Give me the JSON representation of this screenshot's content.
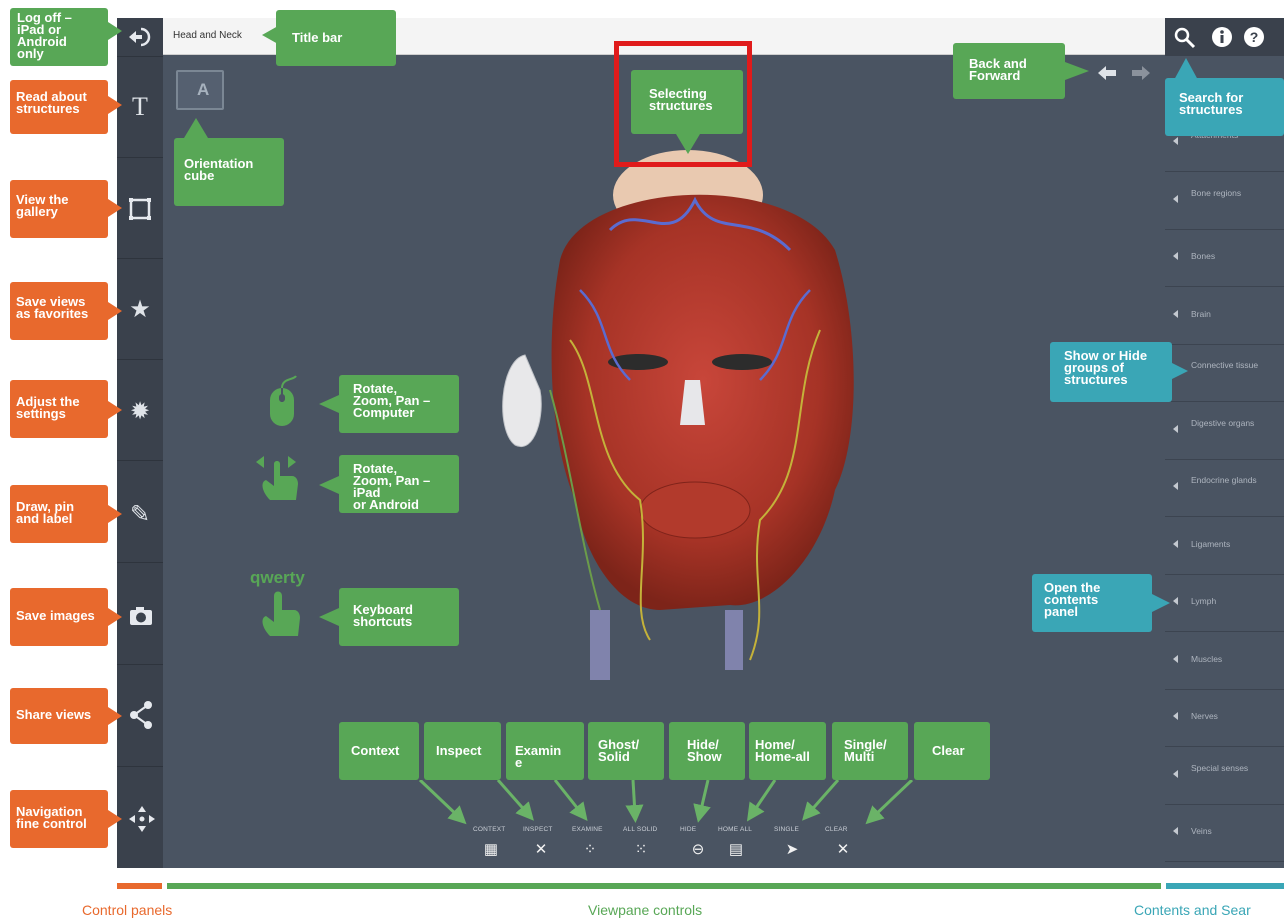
{
  "titlebar": {
    "document_title": "Head and Neck"
  },
  "left_callouts": [
    {
      "id": "logoff",
      "lines": [
        "Log off –",
        "iPad or",
        "Android",
        "only"
      ]
    },
    {
      "id": "read",
      "lines": [
        "Read about",
        "structures"
      ]
    },
    {
      "id": "gallery",
      "lines": [
        "View the",
        "gallery"
      ]
    },
    {
      "id": "favorites",
      "lines": [
        "Save views",
        "as favorites"
      ]
    },
    {
      "id": "settings",
      "lines": [
        "Adjust the",
        "settings"
      ]
    },
    {
      "id": "draw",
      "lines": [
        "Draw, pin",
        "and label"
      ]
    },
    {
      "id": "save_images",
      "lines": [
        "Save images"
      ]
    },
    {
      "id": "share",
      "lines": [
        "Share views"
      ]
    },
    {
      "id": "navigation",
      "lines": [
        "Navigation",
        "fine control"
      ]
    }
  ],
  "callouts": {
    "title_bar": "Title bar",
    "orientation": [
      "Orientation",
      "cube"
    ],
    "selecting": [
      "Selecting",
      "structures"
    ],
    "back_forward": [
      "Back and",
      "Forward"
    ],
    "search": [
      "Search for",
      "structures"
    ],
    "show_hide": [
      "Show or Hide",
      "groups of",
      "structures"
    ],
    "open_contents": [
      "Open the",
      "contents",
      "panel"
    ],
    "rotate_computer": [
      "Rotate,",
      "Zoom, Pan –",
      "Computer"
    ],
    "rotate_ipad": [
      "Rotate,",
      "Zoom, Pan –",
      "iPad",
      "or Android"
    ],
    "keyboard": [
      "Keyboard",
      "shortcuts"
    ],
    "keyboard_icon_text": "qwerty",
    "context": "Context",
    "inspect": "Inspect",
    "examine": [
      "Examin",
      "e"
    ],
    "ghost": [
      "Ghost/",
      "Solid"
    ],
    "hide": [
      "Hide/",
      "Show"
    ],
    "home": [
      "Home/",
      "Home-all"
    ],
    "single": [
      "Single/",
      "Multi"
    ],
    "clear": "Clear"
  },
  "orientation_cube_letter": "A",
  "contents_panel": [
    "Attachments",
    "Bone regions",
    "Bones",
    "Brain",
    "Connective tissue",
    "Digestive organs",
    "Endocrine glands",
    "Ligaments",
    "Lymph",
    "Muscles",
    "Nerves",
    "Special senses",
    "Veins"
  ],
  "view_controls": [
    {
      "label": "CONTEXT",
      "icon": "context-icon"
    },
    {
      "label": "INSPECT",
      "icon": "inspect-icon"
    },
    {
      "label": "EXAMINE",
      "icon": "examine-icon"
    },
    {
      "label": "ALL SOLID",
      "icon": "ghost-solid-icon"
    },
    {
      "label": "HIDE",
      "icon": "hide-icon"
    },
    {
      "label": "HOME ALL",
      "icon": "home-icon"
    },
    {
      "label": "SINGLE",
      "icon": "single-select-icon"
    },
    {
      "label": "CLEAR",
      "icon": "clear-icon"
    }
  ],
  "footer": {
    "control_panels": "Control panels",
    "viewpane_controls": "Viewpane controls",
    "contents_search": "Contents and Sear"
  },
  "colors": {
    "orange": "#e8692d",
    "green": "#58a756",
    "teal": "#3aa6b6",
    "highlight_red": "#e01b1b",
    "viewport_bg": "#4a5462"
  }
}
